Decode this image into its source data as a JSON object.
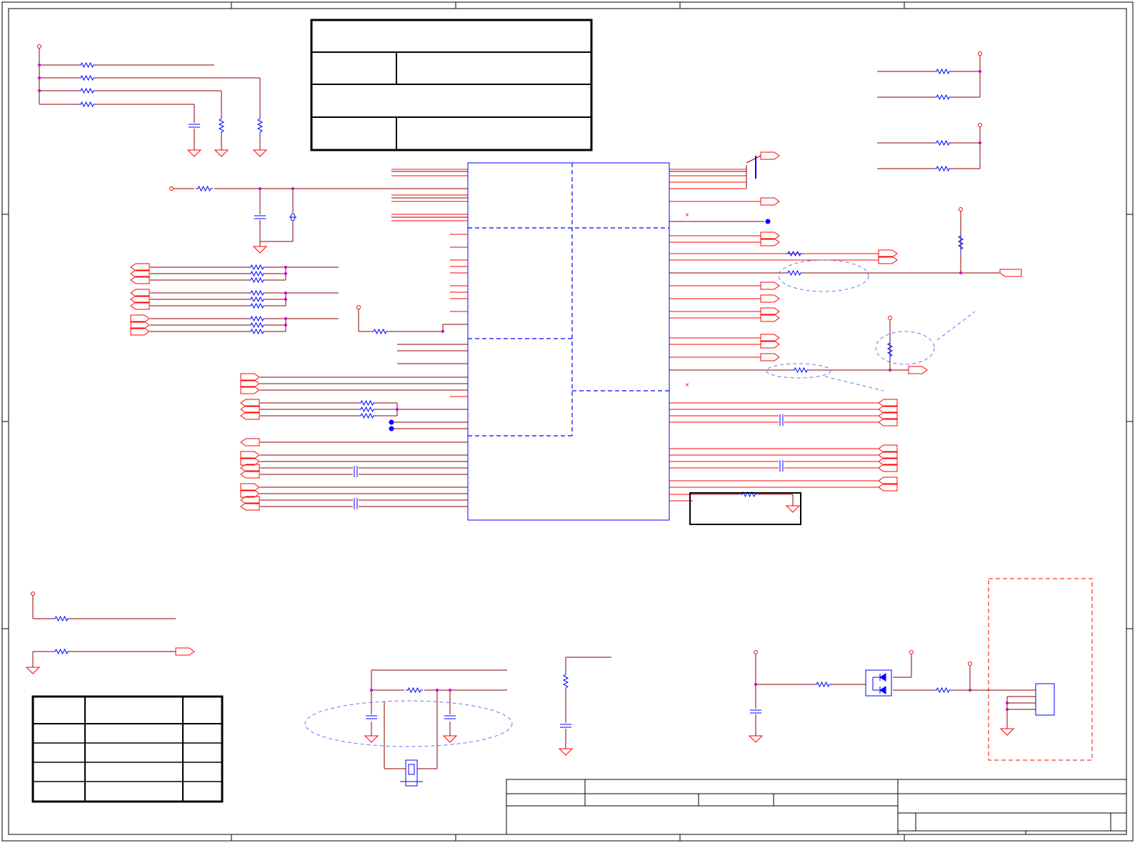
{
  "sheet": {
    "description_visible_text": [],
    "colors": {
      "wire": "#8b0000",
      "wire_red": "#ff0000",
      "component": "#0000ff",
      "junction": "#cc00cc",
      "frame": "#000000",
      "dashed_note": "#6677ee",
      "dashed_red": "#ff0000"
    },
    "icons": [
      "resistor-icon",
      "capacitor-icon",
      "ground-icon",
      "power-pin-icon",
      "off-page-connector-icon",
      "crystal-icon",
      "diode-array-icon",
      "no-connect-icon"
    ]
  }
}
